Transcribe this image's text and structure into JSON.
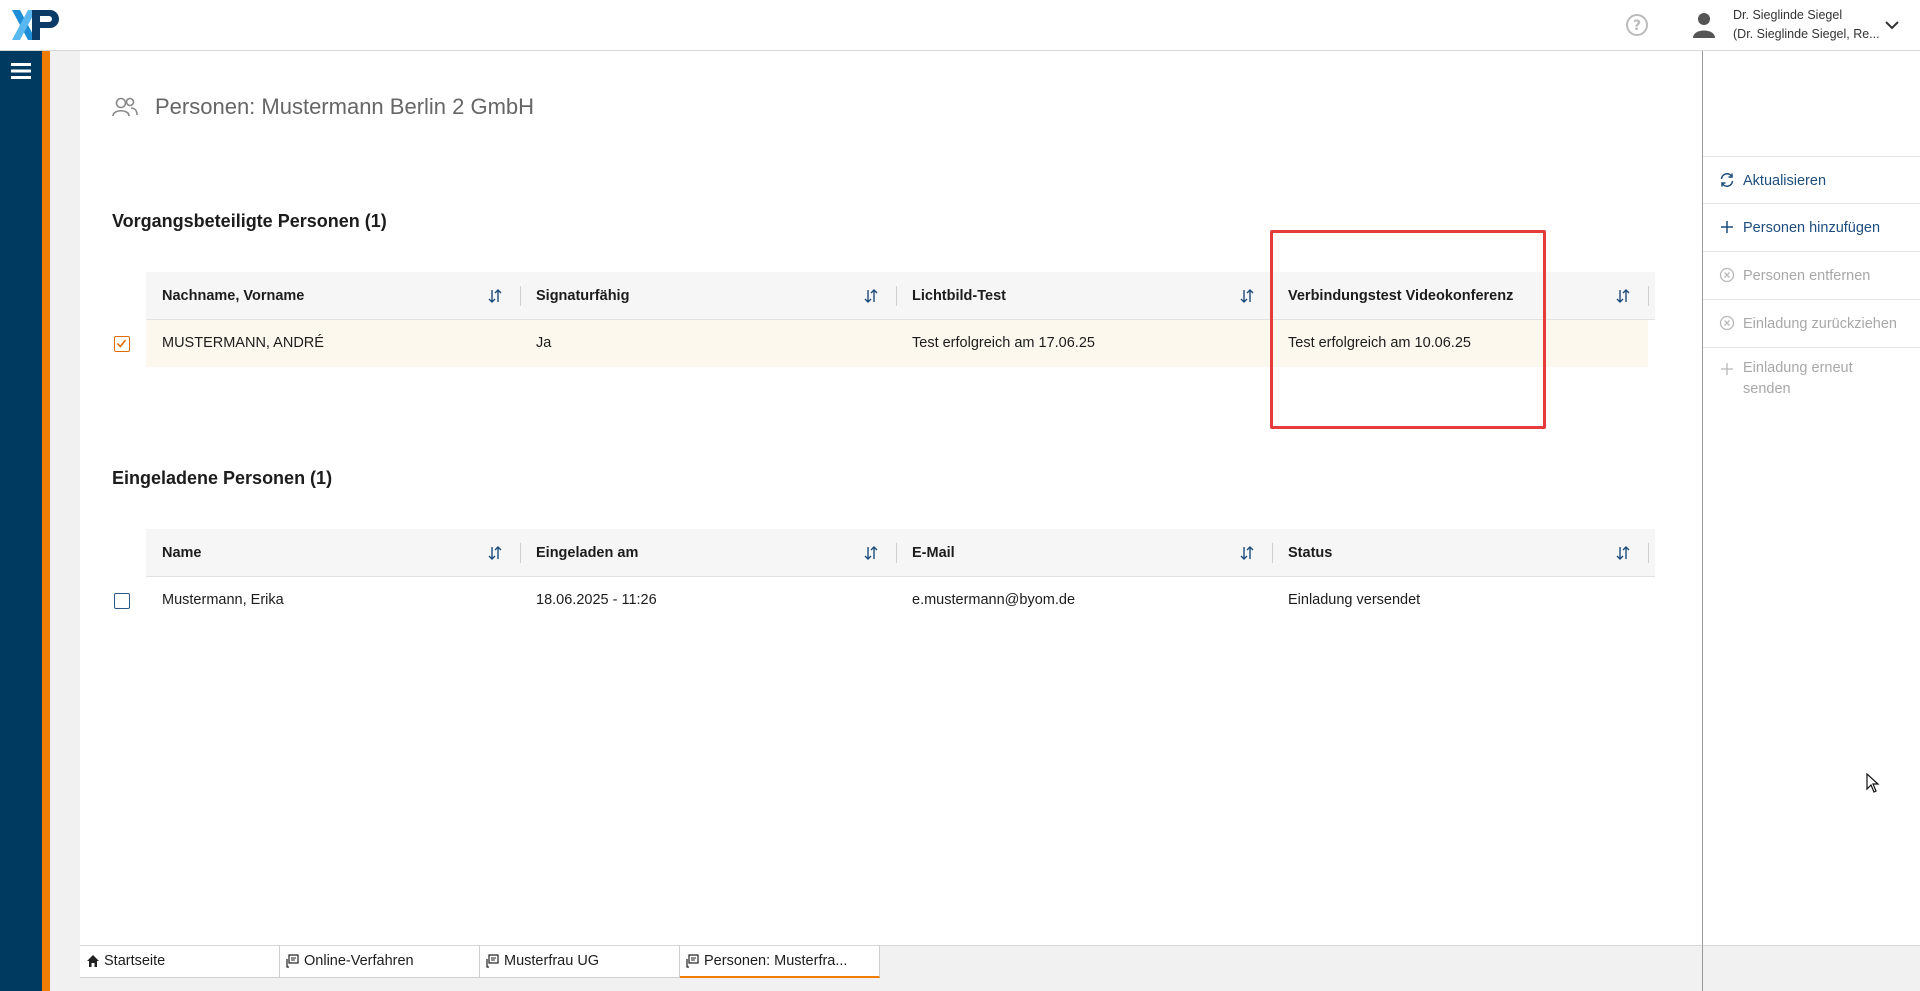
{
  "header": {
    "logo_text": "XP",
    "user_name": "Dr. Sieglinde Siegel",
    "user_sub": "(Dr. Sieglinde Siegel, Re..."
  },
  "page": {
    "title": "Personen: Mustermann Berlin 2 GmbH"
  },
  "section1": {
    "title": "Vorgangsbeteiligte Personen (1)",
    "columns": [
      "Nachname, Vorname",
      "Signaturfähig",
      "Lichtbild-Test",
      "Verbindungstest Videokonferenz"
    ],
    "rows": [
      {
        "checked": true,
        "cells": [
          "MUSTERMANN, ANDRÉ",
          "Ja",
          "Test erfolgreich am 17.06.25",
          "Test erfolgreich am 10.06.25"
        ]
      }
    ]
  },
  "section2": {
    "title": "Eingeladene Personen (1)",
    "columns": [
      "Name",
      "Eingeladen am",
      "E-Mail",
      "Status"
    ],
    "rows": [
      {
        "checked": false,
        "cells": [
          "Mustermann, Erika",
          "18.06.2025 - 11:26",
          "e.mustermann@byom.de",
          "Einladung versendet"
        ]
      }
    ]
  },
  "actions": [
    {
      "label": "Aktualisieren",
      "enabled": true,
      "icon": "refresh-icon"
    },
    {
      "label": "Personen hinzufügen",
      "enabled": true,
      "icon": "plus-icon"
    },
    {
      "label": "Personen entfernen",
      "enabled": false,
      "icon": "circle-x-icon"
    },
    {
      "label": "Einladung zurückziehen",
      "enabled": false,
      "icon": "circle-x-icon"
    },
    {
      "label_line1": "Einladung erneut",
      "label_line2": "senden",
      "enabled": false,
      "icon": "plus-icon"
    }
  ],
  "tabs": [
    {
      "label": "Startseite",
      "icon": "home-icon",
      "active": false
    },
    {
      "label": "Online-Verfahren",
      "icon": "document-icon",
      "active": false
    },
    {
      "label": "Musterfrau UG",
      "icon": "document-icon",
      "active": false
    },
    {
      "label": "Personen: Musterfra...",
      "icon": "document-icon",
      "active": true
    }
  ],
  "colors": {
    "rail": "#003a60",
    "accent": "#f07d00",
    "link": "#1d4d7d",
    "highlight": "#e53b3b"
  }
}
